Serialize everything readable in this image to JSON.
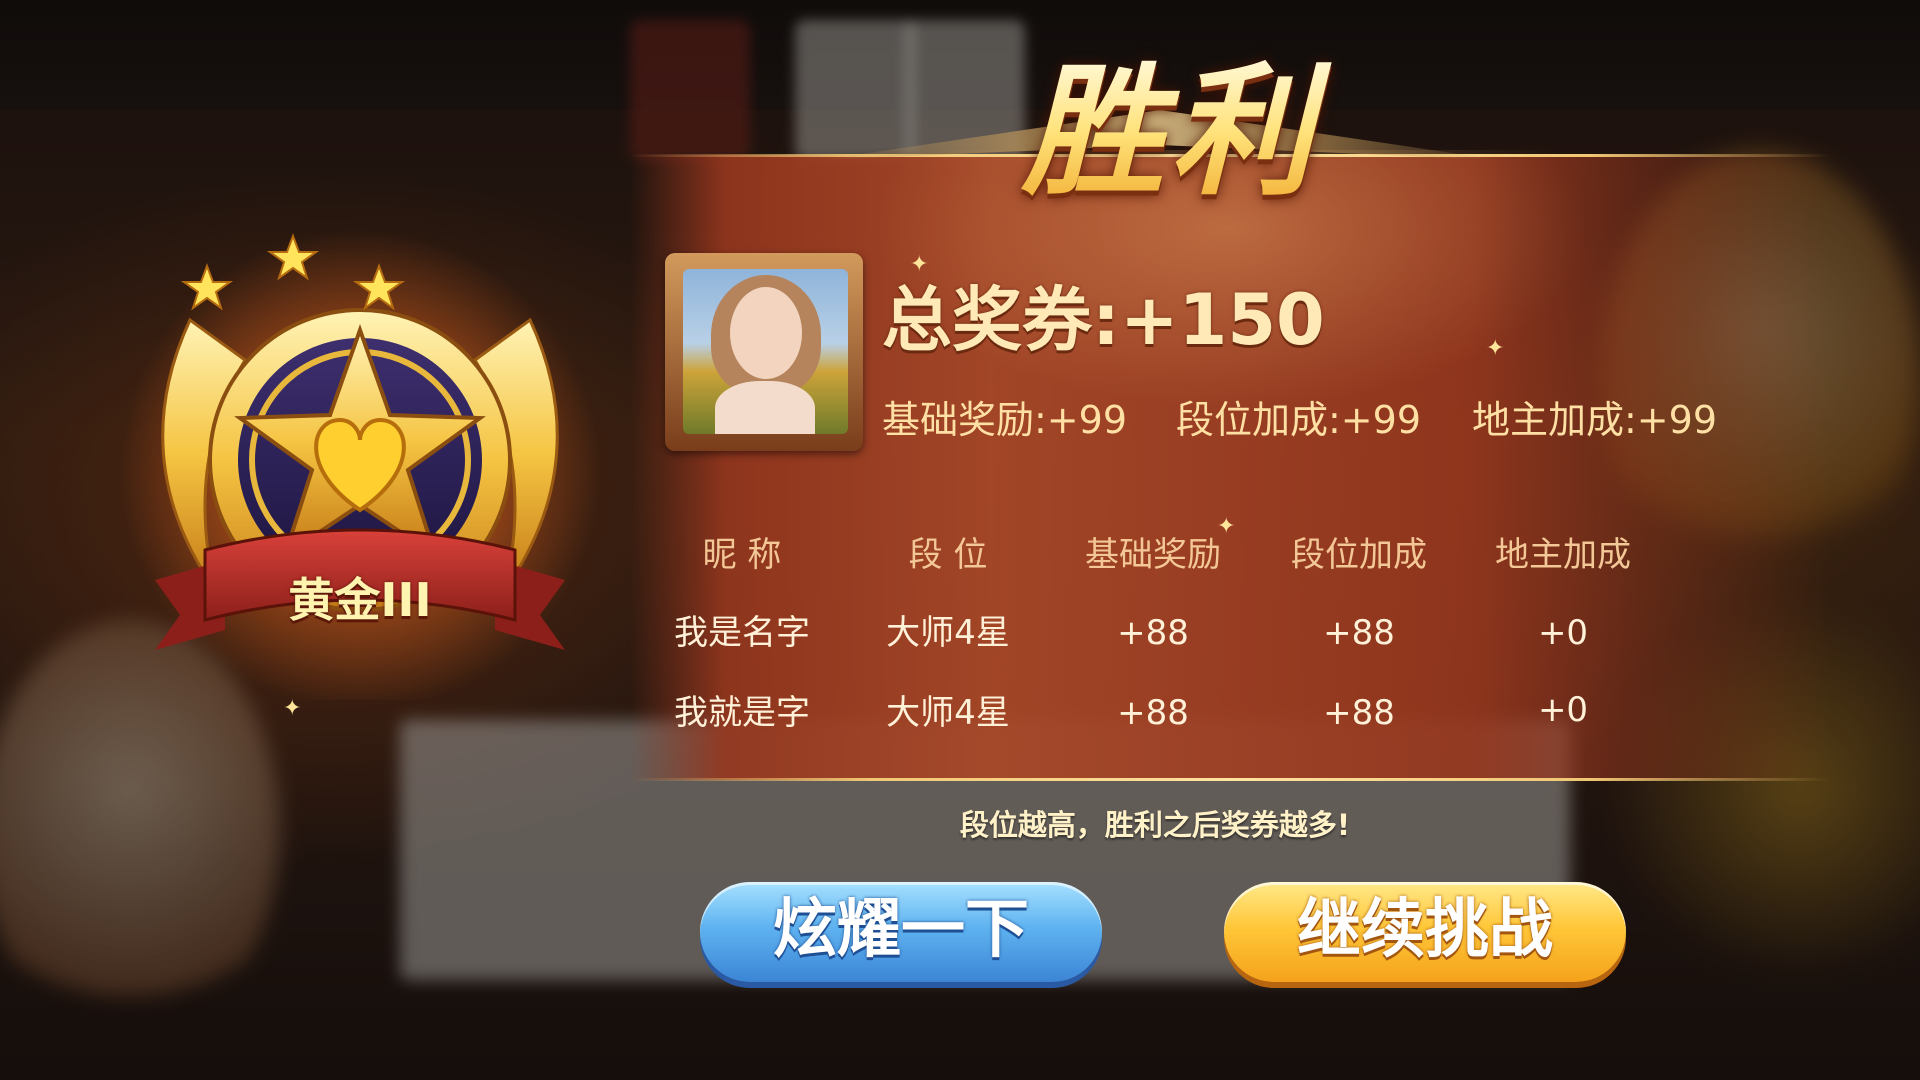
{
  "title": "胜利",
  "player": {
    "total_label": "总奖券:+150",
    "bonuses": [
      "基础奖励:+99",
      "段位加成:+99",
      "地主加成:+99"
    ]
  },
  "rank_badge": {
    "label": "黄金III",
    "stars": 3
  },
  "table": {
    "headers": [
      "昵 称",
      "段 位",
      "基础奖励",
      "段位加成",
      "地主加成"
    ],
    "rows": [
      [
        "我是名字",
        "大师4星",
        "+88",
        "+88",
        "+0"
      ],
      [
        "我就是字",
        "大师4星",
        "+88",
        "+88",
        "+0"
      ]
    ]
  },
  "hint": "段位越高，胜利之后奖券越多!",
  "buttons": {
    "show_off": "炫耀一下",
    "continue": "继续挑战"
  },
  "colors": {
    "gold": "#ffe27a",
    "panel": "#a8482a",
    "blue_button": "#5fb3f0",
    "yellow_button": "#ffc739"
  }
}
